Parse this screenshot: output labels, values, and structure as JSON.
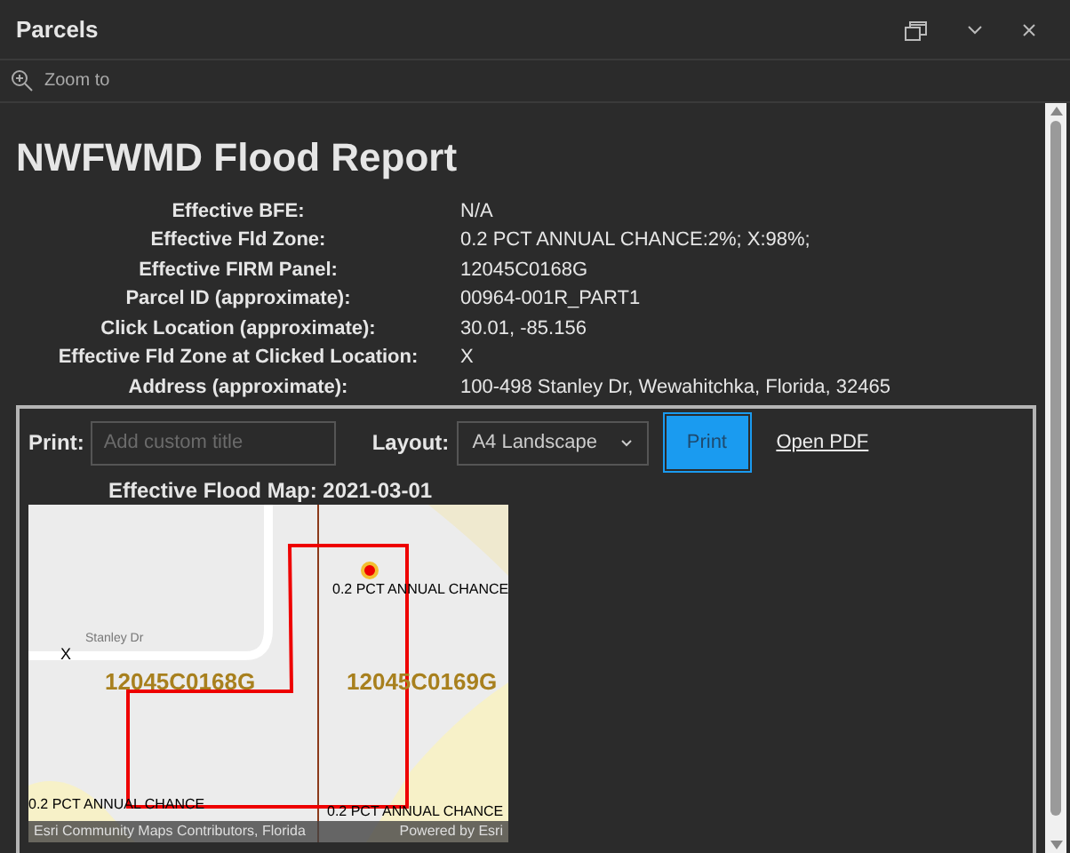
{
  "window": {
    "title": "Parcels"
  },
  "toolbar": {
    "zoom_to": "Zoom to"
  },
  "report": {
    "title": "NWFWMD Flood Report",
    "fields": [
      {
        "label": "Effective BFE:",
        "value": "N/A"
      },
      {
        "label": "Effective Fld Zone:",
        "value": "0.2 PCT ANNUAL CHANCE:2%; X:98%;"
      },
      {
        "label": "Effective FIRM Panel:",
        "value": "12045C0168G"
      },
      {
        "label": "Parcel ID (approximate):",
        "value": "00964-001R_PART1"
      },
      {
        "label": "Click Location (approximate):",
        "value": "30.01, -85.156"
      },
      {
        "label": "Effective Fld Zone at Clicked Location:",
        "value": "X"
      },
      {
        "label": "Address (approximate):",
        "value": "100-498 Stanley Dr, Wewahitchka, Florida, 32465"
      }
    ]
  },
  "print": {
    "label": "Print:",
    "title_placeholder": "Add custom title",
    "layout_label": "Layout:",
    "layout_value": "A4 Landscape",
    "button": "Print",
    "open_pdf": "Open PDF"
  },
  "map": {
    "title": "Effective Flood Map: 2021-03-01",
    "labels": [
      {
        "kind": "zone",
        "text": "0.2 PCT ANNUAL CHANCE"
      },
      {
        "kind": "marker",
        "text": "X"
      },
      {
        "kind": "road",
        "text": "Stanley Dr"
      },
      {
        "kind": "panel",
        "text": "12045C0168G"
      },
      {
        "kind": "panel",
        "text": "12045C0169G"
      },
      {
        "kind": "zone",
        "text": "0.2 PCT ANNUAL CHANCE"
      },
      {
        "kind": "zone",
        "text": "0.2 PCT ANNUAL CHANCE"
      }
    ],
    "attribution": "Esri Community Maps Contributors, Florida",
    "powered_by": "Powered by Esri"
  }
}
